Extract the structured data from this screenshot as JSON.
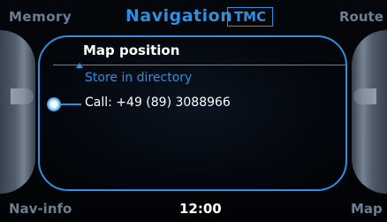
{
  "header": {
    "left_softkey": "Memory",
    "title": "Navigation",
    "badge": "TMC",
    "right_softkey": "Route"
  },
  "menu": {
    "title": "Map position",
    "items": [
      {
        "label": "Store in directory"
      },
      {
        "label": "Call: +49 (89) 3088966"
      }
    ]
  },
  "footer": {
    "left_softkey": "Nav-info",
    "clock": "12:00",
    "right_softkey": "Map"
  },
  "colors": {
    "accent": "#2f8fe0",
    "softkey_text": "#6a7f93",
    "primary_text": "#ffffff",
    "background": "#020305"
  }
}
